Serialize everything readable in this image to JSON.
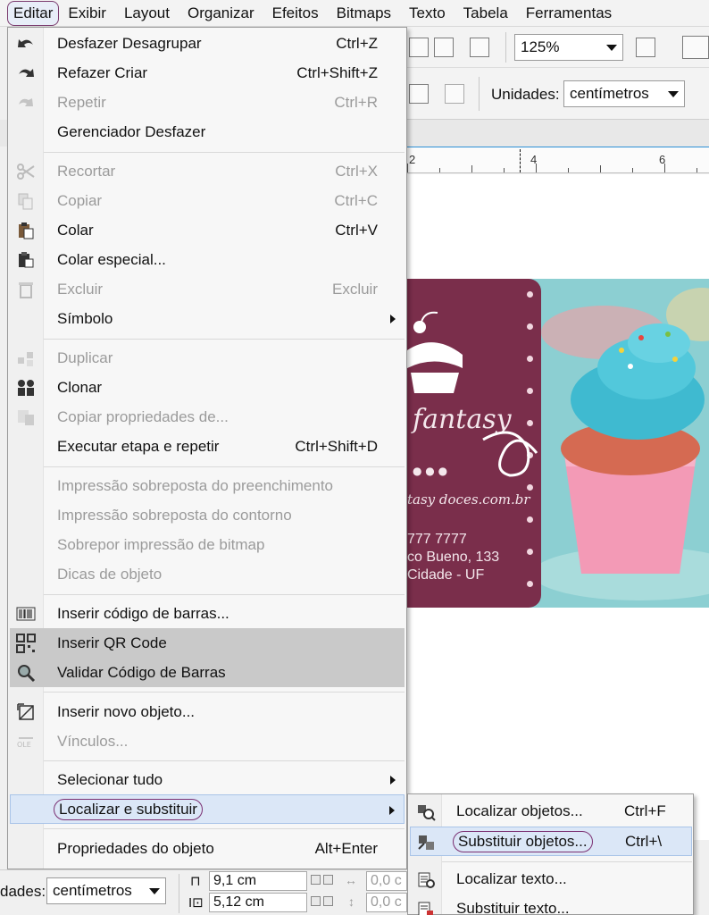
{
  "menubar": {
    "items": [
      "Editar",
      "Exibir",
      "Layout",
      "Organizar",
      "Efeitos",
      "Bitmaps",
      "Texto",
      "Tabela",
      "Ferramentas"
    ]
  },
  "toolbar": {
    "zoom": "125%",
    "units_label": "Unidades:",
    "units_value": "centímetros"
  },
  "ruler": {
    "ticks": [
      "2",
      "4",
      "6"
    ]
  },
  "card": {
    "brand": "fantasy",
    "site": "tasy doces.com.br",
    "phone": "777 7777",
    "address": "co Bueno, 133",
    "city": "Cidade - UF"
  },
  "menu": {
    "items": [
      {
        "label": "Desfazer Desagrupar",
        "shortcut": "Ctrl+Z",
        "icon": "undo-icon",
        "enabled": true
      },
      {
        "label": "Refazer Criar",
        "shortcut": "Ctrl+Shift+Z",
        "icon": "redo-icon",
        "enabled": true
      },
      {
        "label": "Repetir",
        "shortcut": "Ctrl+R",
        "icon": "repeat-icon",
        "enabled": false
      },
      {
        "label": "Gerenciador Desfazer",
        "shortcut": "",
        "icon": "",
        "enabled": true
      },
      {
        "label": "Recortar",
        "shortcut": "Ctrl+X",
        "icon": "scissors-icon",
        "enabled": false
      },
      {
        "label": "Copiar",
        "shortcut": "Ctrl+C",
        "icon": "copy-icon",
        "enabled": false
      },
      {
        "label": "Colar",
        "shortcut": "Ctrl+V",
        "icon": "paste-icon",
        "enabled": true
      },
      {
        "label": "Colar especial...",
        "shortcut": "",
        "icon": "paste-special-icon",
        "enabled": true
      },
      {
        "label": "Excluir",
        "shortcut": "Excluir",
        "icon": "trash-icon",
        "enabled": false
      },
      {
        "label": "Símbolo",
        "shortcut": "",
        "icon": "",
        "enabled": true,
        "submenu": true
      },
      {
        "label": "Duplicar",
        "shortcut": "",
        "icon": "duplicate-icon",
        "enabled": false
      },
      {
        "label": "Clonar",
        "shortcut": "",
        "icon": "clone-icon",
        "enabled": true
      },
      {
        "label": "Copiar propriedades de...",
        "shortcut": "",
        "icon": "copy-properties-icon",
        "enabled": false
      },
      {
        "label": "Executar etapa e repetir",
        "shortcut": "Ctrl+Shift+D",
        "icon": "",
        "enabled": true
      },
      {
        "label": "Impressão sobreposta do preenchimento",
        "shortcut": "",
        "icon": "",
        "enabled": false
      },
      {
        "label": "Impressão sobreposta do contorno",
        "shortcut": "",
        "icon": "",
        "enabled": false
      },
      {
        "label": "Sobrepor impressão de bitmap",
        "shortcut": "",
        "icon": "",
        "enabled": false
      },
      {
        "label": "Dicas de objeto",
        "shortcut": "",
        "icon": "",
        "enabled": false
      },
      {
        "label": "Inserir código de barras...",
        "shortcut": "",
        "icon": "barcode-icon",
        "enabled": true
      },
      {
        "label": "Inserir QR Code",
        "shortcut": "",
        "icon": "qr-code-icon",
        "enabled": true
      },
      {
        "label": "Validar Código de Barras",
        "shortcut": "",
        "icon": "magnifier-icon",
        "enabled": true
      },
      {
        "label": "Inserir novo objeto...",
        "shortcut": "",
        "icon": "new-object-icon",
        "enabled": true
      },
      {
        "label": "Vínculos...",
        "shortcut": "",
        "icon": "ole-icon",
        "enabled": false
      },
      {
        "label": "Selecionar tudo",
        "shortcut": "",
        "icon": "",
        "enabled": true,
        "submenu": true
      },
      {
        "label": "Localizar e substituir",
        "shortcut": "",
        "icon": "",
        "enabled": true,
        "submenu": true
      },
      {
        "label": "Propriedades do objeto",
        "shortcut": "Alt+Enter",
        "icon": "",
        "enabled": true
      }
    ]
  },
  "submenu": {
    "items": [
      {
        "label": "Localizar objetos...",
        "shortcut": "Ctrl+F",
        "icon": "find-objects-icon"
      },
      {
        "label": "Substituir objetos...",
        "shortcut": "Ctrl+\\",
        "icon": "replace-objects-icon"
      },
      {
        "label": "Localizar texto...",
        "shortcut": "",
        "icon": "find-text-icon"
      },
      {
        "label": "Substituir texto...",
        "shortcut": "",
        "icon": "replace-text-icon"
      }
    ]
  },
  "bottombar": {
    "units_label": "dades:",
    "units_value": "centímetros",
    "width": "9,1 cm",
    "height": "5,12 cm",
    "offset_x": "0,0 c",
    "offset_y": "0,0 c"
  }
}
